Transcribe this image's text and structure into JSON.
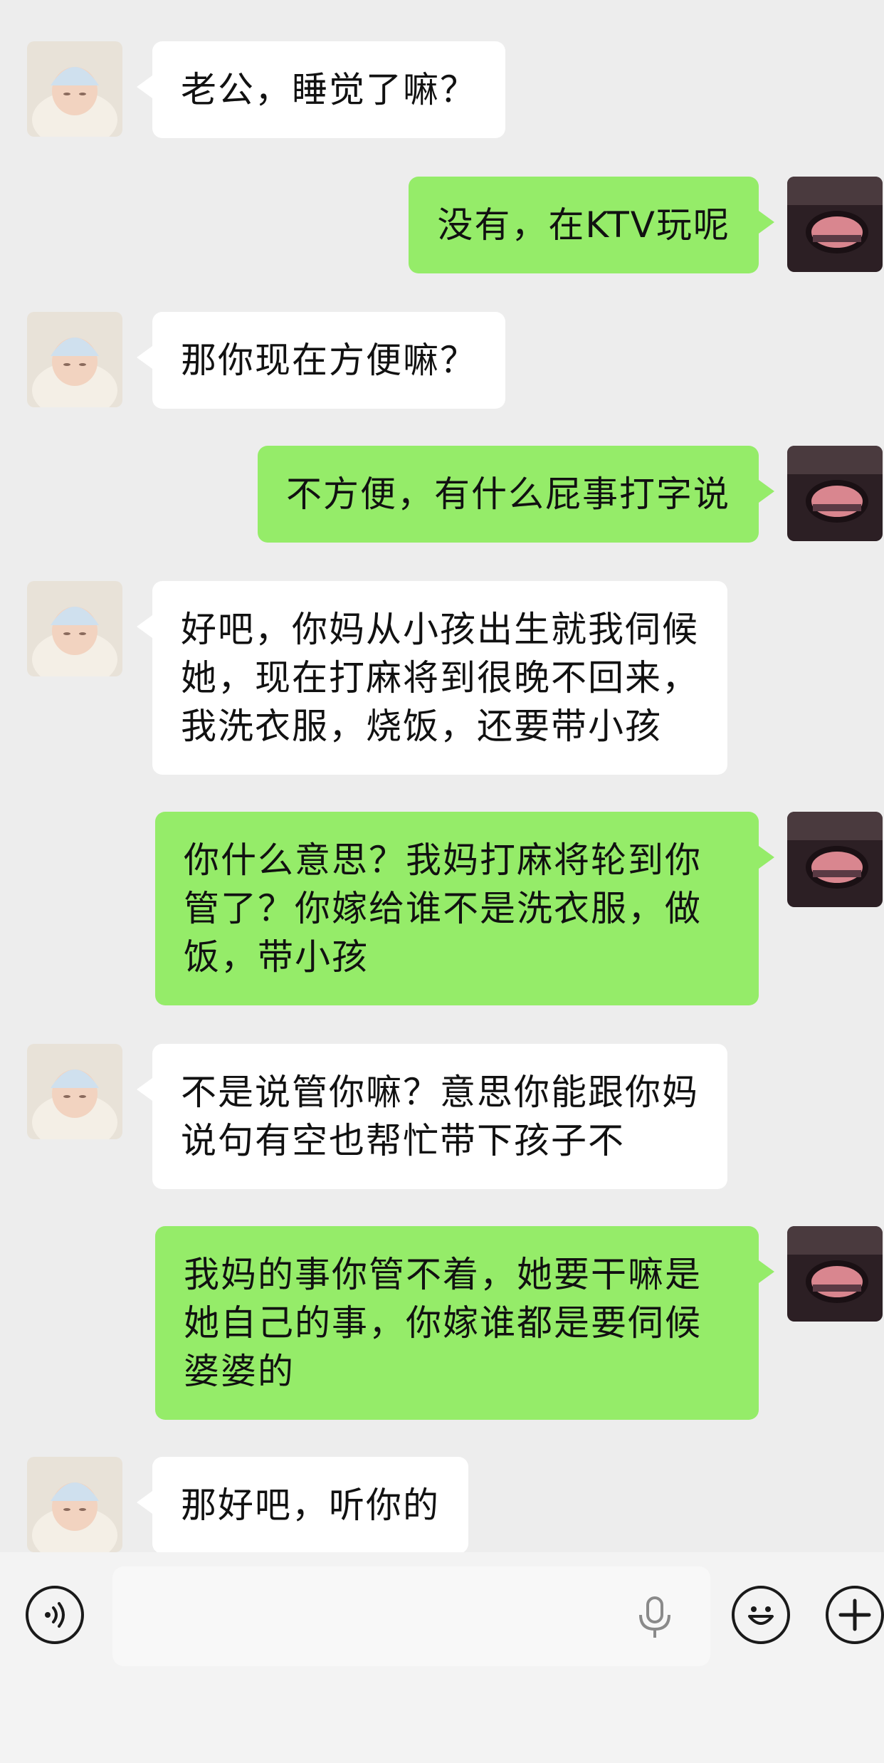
{
  "messages": [
    {
      "side": "in",
      "text": "老公，睡觉了嘛？"
    },
    {
      "side": "out",
      "text": "没有，在KTV玩呢"
    },
    {
      "side": "in",
      "text": "那你现在方便嘛？"
    },
    {
      "side": "out",
      "text": "不方便，有什么屁事打字说"
    },
    {
      "side": "in",
      "text": "好吧，你妈从小孩出生就我伺候\n她，现在打麻将到很晚不回来，\n我洗衣服，烧饭，还要带小孩"
    },
    {
      "side": "out",
      "text": "你什么意思？我妈打麻将轮到你\n管了？你嫁给谁不是洗衣服，做\n饭，带小孩"
    },
    {
      "side": "in",
      "text": "不是说管你嘛？意思你能跟你妈\n说句有空也帮忙带下孩子不"
    },
    {
      "side": "out",
      "text": "我妈的事你管不着，她要干嘛是\n她自己的事，你嫁谁都是要伺候\n婆婆的"
    },
    {
      "side": "in",
      "text": "那好吧，听你的"
    }
  ],
  "input_bar": {
    "placeholder": "",
    "voice_icon": "voice-icon",
    "mic_icon": "microphone-icon",
    "emoji_icon": "emoji-icon",
    "plus_icon": "plus-icon"
  },
  "colors": {
    "background": "#ededed",
    "incoming_bubble": "#ffffff",
    "outgoing_bubble": "#95ec69"
  }
}
